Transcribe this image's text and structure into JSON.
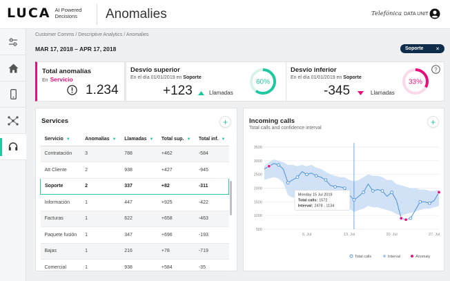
{
  "brand": {
    "logo": "LUCA",
    "tagline_1": "AI Powered",
    "tagline_2": "Decisions",
    "partner_1": "Telefónica",
    "partner_2": "DATA UNIT"
  },
  "app": {
    "title": "Anomalies"
  },
  "breadcrumb": "Customer Comms / Descriptive Analytics / Anomalies",
  "date_range": "MAR 17, 2018 – APR 17, 2018",
  "filter": {
    "label": "Soporte",
    "close": "✕"
  },
  "sidebar": {
    "items": [
      {
        "icon": "sliders-icon",
        "active": false
      },
      {
        "icon": "home-icon",
        "active": false
      },
      {
        "icon": "mobile-icon",
        "active": false
      },
      {
        "icon": "network-icon",
        "active": false
      },
      {
        "icon": "headset-icon",
        "active": true
      }
    ]
  },
  "kpi_total": {
    "title": "Total anomalías",
    "prefix": "En",
    "highlight": "Servicio",
    "value": "1.234",
    "accent": "#e5117a"
  },
  "kpi_upper": {
    "title": "Desvío superior",
    "sub_prefix": "En el día 01/01/2019 en",
    "sub_service": "Soporte",
    "value": "+123",
    "unit": "Llamadas",
    "percent_label": "60%",
    "percent": 0.6,
    "color": "#1ec8a0"
  },
  "kpi_lower": {
    "title": "Desvío inferior",
    "sub_prefix": "En el día 01/01/2019 en",
    "sub_service": "Soporte",
    "value": "-345",
    "unit": "Llamadas",
    "percent_label": "33%",
    "percent": 0.33,
    "color": "#e5117a"
  },
  "services": {
    "title": "Services",
    "columns": [
      "Servicio",
      "Anomalías",
      "Llamadas",
      "Total sup.",
      "Total inf."
    ],
    "rows": [
      [
        "Contratación",
        "3",
        "788",
        "+462",
        "-584"
      ],
      [
        "Att Cliente",
        "2",
        "938",
        "+427",
        "-945"
      ],
      [
        "Soporte",
        "2",
        "337",
        "+82",
        "-311"
      ],
      [
        "Información",
        "1",
        "447",
        "+925",
        "-422"
      ],
      [
        "Facturas",
        "1",
        "622",
        "+658",
        "-463"
      ],
      [
        "Paquete fusión",
        "1",
        "347",
        "+696",
        "-193"
      ],
      [
        "Bajas",
        "1",
        "216",
        "+78",
        "-719"
      ],
      [
        "Comercial",
        "1",
        "938",
        "+584",
        "-35"
      ]
    ]
  },
  "incoming": {
    "title": "Incoming calls",
    "subtitle": "Total calls and confidence interval"
  },
  "chart_data": {
    "type": "line",
    "ylim": [
      500,
      3500
    ],
    "yticks": [
      500,
      1000,
      1500,
      2000,
      2500,
      3000,
      3500
    ],
    "xlim": [
      0,
      37
    ],
    "xticks": [
      {
        "x": 9,
        "label": "6. Jul"
      },
      {
        "x": 18,
        "label": "13. Jul"
      },
      {
        "x": 27,
        "label": "20. Jul"
      },
      {
        "x": 36,
        "label": "27. Jul"
      }
    ],
    "grid": true,
    "legend": [
      {
        "name": "Total calls",
        "color": "#4a90d9"
      },
      {
        "name": "Interval",
        "color": "#a8c8ee"
      },
      {
        "name": "Anomaly",
        "color": "#e5117a"
      }
    ],
    "series": [
      {
        "name": "Total calls",
        "x": [
          0,
          1,
          2,
          3,
          4,
          5,
          6,
          7,
          8,
          9,
          10,
          11,
          12,
          13,
          14,
          15,
          16,
          17,
          18,
          19,
          20,
          21,
          22,
          23,
          24,
          25,
          26,
          27,
          28,
          29,
          30,
          31,
          32,
          33,
          34,
          35,
          36,
          37
        ],
        "y": [
          2700,
          2800,
          2900,
          2850,
          2700,
          2200,
          2300,
          2400,
          2600,
          2500,
          2550,
          2450,
          2400,
          2300,
          2100,
          2050,
          2050,
          2000,
          1750,
          1572,
          1700,
          1850,
          2150,
          1900,
          1950,
          1900,
          1700,
          1850,
          1550,
          900,
          850,
          900,
          1200,
          1500,
          1500,
          1450,
          1550,
          1850
        ]
      },
      {
        "name": "Interval",
        "upper": [
          2800,
          2950,
          3050,
          3000,
          2950,
          2850,
          2850,
          2800,
          2850,
          2800,
          2850,
          2750,
          2700,
          2600,
          2500,
          2450,
          2400,
          2400,
          2300,
          2250,
          2300,
          2400,
          2500,
          2450,
          2450,
          2400,
          2300,
          2300,
          2150,
          2100,
          2050,
          2000,
          2000,
          1950,
          1950,
          1900,
          1900,
          1950
        ],
        "lower": [
          2300,
          2350,
          2400,
          2350,
          2200,
          1750,
          1650,
          1700,
          1800,
          1750,
          1700,
          1650,
          1650,
          1600,
          1500,
          1400,
          1400,
          1350,
          1250,
          1134,
          1200,
          1250,
          1350,
          1300,
          1300,
          1250,
          1200,
          1150,
          1050,
          1000,
          1050,
          1100,
          1150,
          1200,
          1250,
          1250,
          1300,
          1350
        ]
      }
    ],
    "anomalies": [
      {
        "x": 1,
        "y": 2800
      },
      {
        "x": 29,
        "y": 900
      },
      {
        "x": 30,
        "y": 850
      },
      {
        "x": 37,
        "y": 1850
      }
    ],
    "crosshair_x": 19,
    "tooltip": {
      "date": "Monday 15 Jul 2019",
      "total_label": "Total calls:",
      "total": "1572",
      "interval_label": "Interval:",
      "interval": "2478 - 1134"
    }
  }
}
